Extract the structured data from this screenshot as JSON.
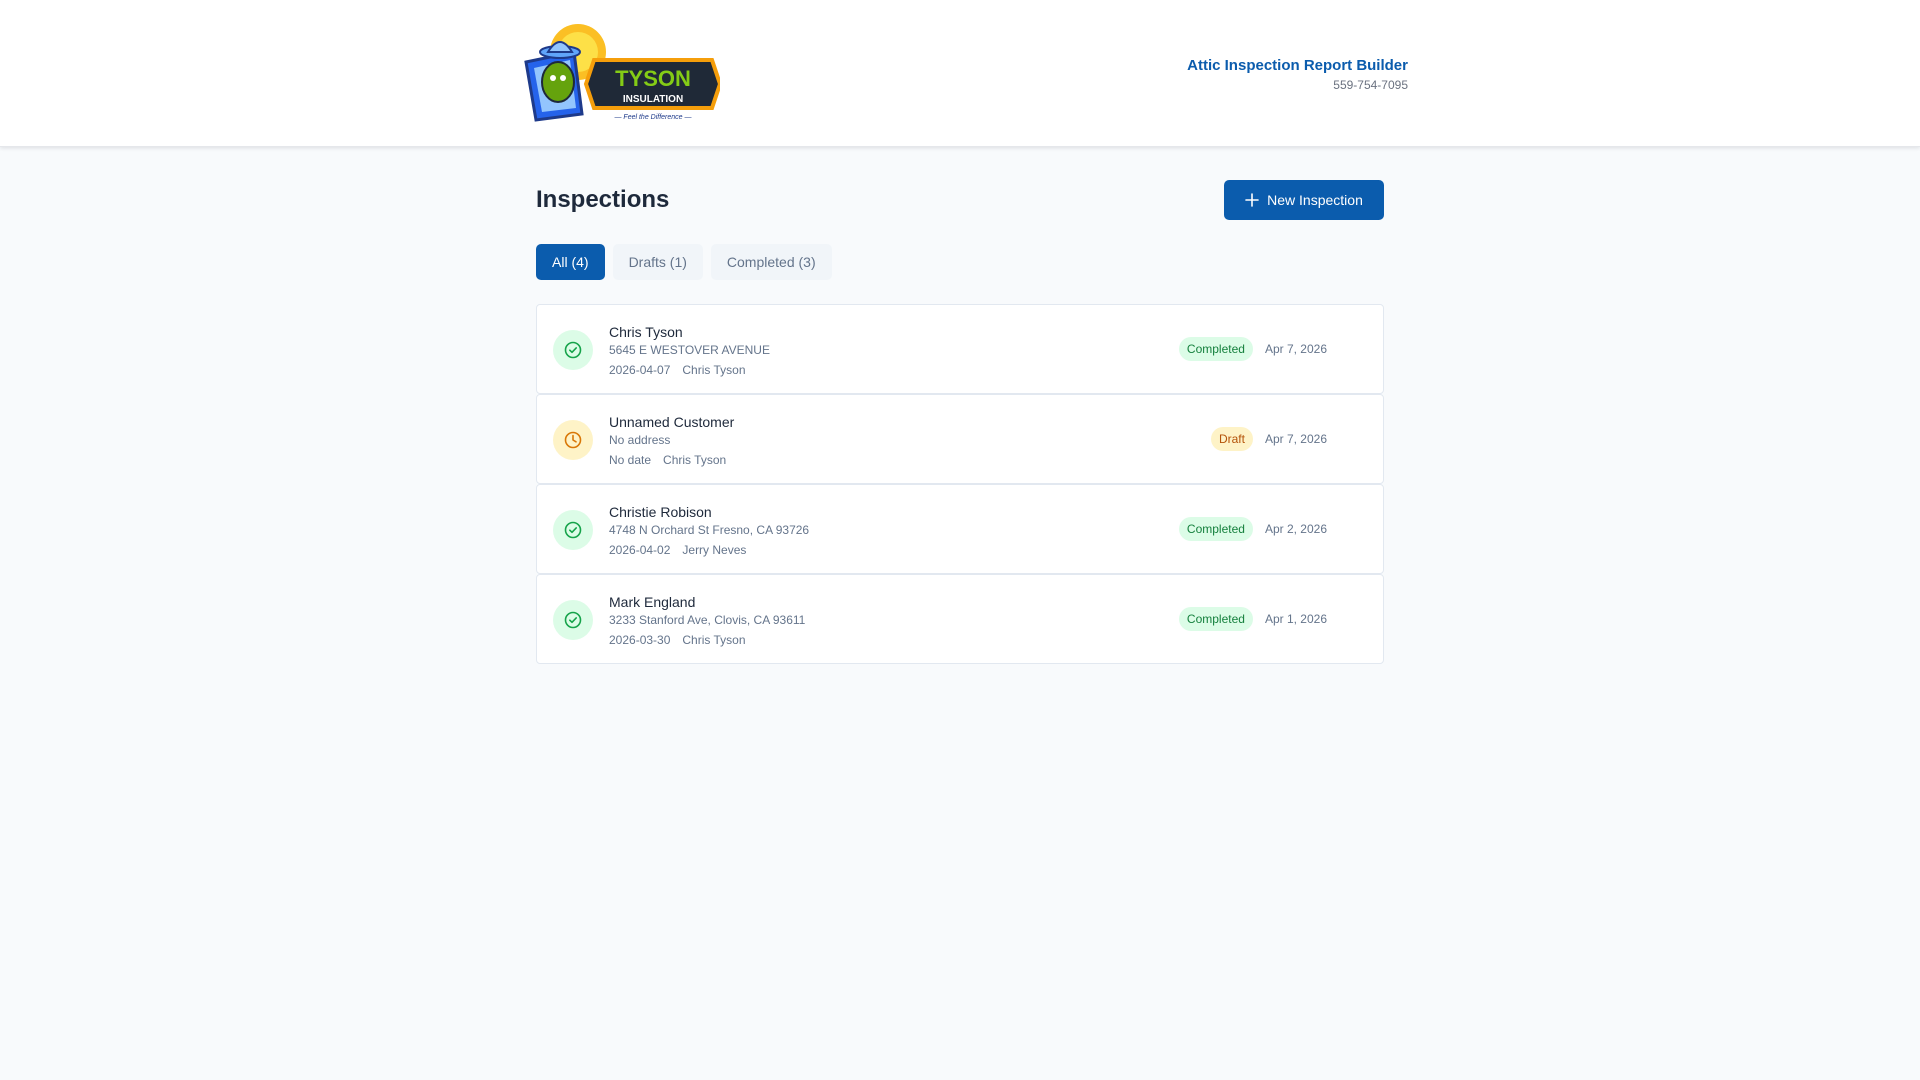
{
  "header": {
    "logo": {
      "brand": "TYSON",
      "sub": "INSULATION",
      "tagline": "— Feel the Difference —"
    },
    "app_title": "Attic Inspection Report Builder",
    "phone": "559-754-7095"
  },
  "main": {
    "title": "Inspections",
    "new_button_label": "New Inspection",
    "tabs": [
      {
        "label": "All (4)",
        "active": true
      },
      {
        "label": "Drafts (1)",
        "active": false
      },
      {
        "label": "Completed (3)",
        "active": false
      }
    ],
    "inspections": [
      {
        "customer": "Chris Tyson",
        "address": "5645 E WESTOVER AVENUE",
        "inspection_date": "2026-04-07",
        "inspector": "Chris Tyson",
        "status": "Completed",
        "status_icon": "check-circle-icon",
        "date": "Apr 7, 2026"
      },
      {
        "customer": "Unnamed Customer",
        "address": "No address",
        "inspection_date": "No date",
        "inspector": "Chris Tyson",
        "status": "Draft",
        "status_icon": "clock-icon",
        "date": "Apr 7, 2026"
      },
      {
        "customer": "Christie Robison",
        "address": "4748 N Orchard St Fresno, CA 93726",
        "inspection_date": "2026-04-02",
        "inspector": "Jerry Neves",
        "status": "Completed",
        "status_icon": "check-circle-icon",
        "date": "Apr 2, 2026"
      },
      {
        "customer": "Mark England",
        "address": "3233 Stanford Ave, Clovis, CA 93611",
        "inspection_date": "2026-03-30",
        "inspector": "Chris Tyson",
        "status": "Completed",
        "status_icon": "check-circle-icon",
        "date": "Apr 1, 2026"
      }
    ]
  },
  "colors": {
    "accent": "#0b5cad",
    "completed_bg": "#dcfce7",
    "completed_fg": "#15803d",
    "draft_bg": "#fef3c7",
    "draft_fg": "#b45309",
    "page_bg": "#f8fafc"
  }
}
